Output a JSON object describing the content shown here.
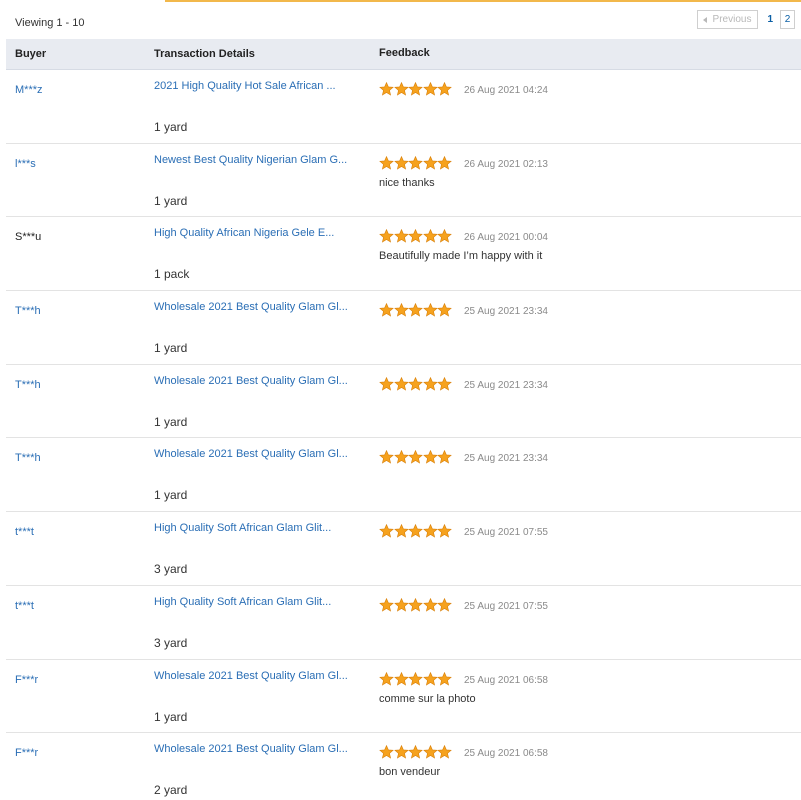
{
  "summary": {
    "viewing": "Viewing 1 - 10"
  },
  "pagination": {
    "previous": "Previous",
    "current": "1",
    "next_page": "2"
  },
  "columns": {
    "buyer": "Buyer",
    "transaction": "Transaction Details",
    "feedback": "Feedback"
  },
  "colors": {
    "link": "#2a6eb5",
    "star": "#f6a21e",
    "header_bg": "#e8ebf1",
    "accent": "#f2b84b"
  },
  "rows": [
    {
      "buyer": "M***z",
      "buyer_style": "link",
      "title": "2021 High Quality Hot Sale African ...",
      "quantity": "1 yard",
      "rating": 5,
      "date": "26 Aug 2021 04:24",
      "comment": ""
    },
    {
      "buyer": "l***s",
      "buyer_style": "link",
      "title": "Newest Best Quality Nigerian Glam G...",
      "quantity": "1 yard",
      "rating": 5,
      "date": "26 Aug 2021 02:13",
      "comment": "nice thanks"
    },
    {
      "buyer": "S***u",
      "buyer_style": "plain",
      "title": "High Quality African Nigeria Gele E...",
      "quantity": "1 pack",
      "rating": 5,
      "date": "26 Aug 2021 00:04",
      "comment": "Beautifully made I’m happy with it"
    },
    {
      "buyer": "T***h",
      "buyer_style": "link",
      "title": "Wholesale 2021 Best Quality Glam Gl...",
      "quantity": "1 yard",
      "rating": 5,
      "date": "25 Aug 2021 23:34",
      "comment": ""
    },
    {
      "buyer": "T***h",
      "buyer_style": "link",
      "title": "Wholesale 2021 Best Quality Glam Gl...",
      "quantity": "1 yard",
      "rating": 5,
      "date": "25 Aug 2021 23:34",
      "comment": ""
    },
    {
      "buyer": "T***h",
      "buyer_style": "link",
      "title": "Wholesale 2021 Best Quality Glam Gl...",
      "quantity": "1 yard",
      "rating": 5,
      "date": "25 Aug 2021 23:34",
      "comment": ""
    },
    {
      "buyer": "t***t",
      "buyer_style": "link",
      "title": "High Quality Soft African Glam Glit...",
      "quantity": "3 yard",
      "rating": 5,
      "date": "25 Aug 2021 07:55",
      "comment": ""
    },
    {
      "buyer": "t***t",
      "buyer_style": "link",
      "title": "High Quality Soft African Glam Glit...",
      "quantity": "3 yard",
      "rating": 5,
      "date": "25 Aug 2021 07:55",
      "comment": ""
    },
    {
      "buyer": "F***r",
      "buyer_style": "link",
      "title": "Wholesale 2021 Best Quality Glam Gl...",
      "quantity": "1 yard",
      "rating": 5,
      "date": "25 Aug 2021 06:58",
      "comment": "comme sur la photo"
    },
    {
      "buyer": "F***r",
      "buyer_style": "link",
      "title": "Wholesale 2021 Best Quality Glam Gl...",
      "quantity": "2 yard",
      "rating": 5,
      "date": "25 Aug 2021 06:58",
      "comment": "bon vendeur"
    }
  ]
}
